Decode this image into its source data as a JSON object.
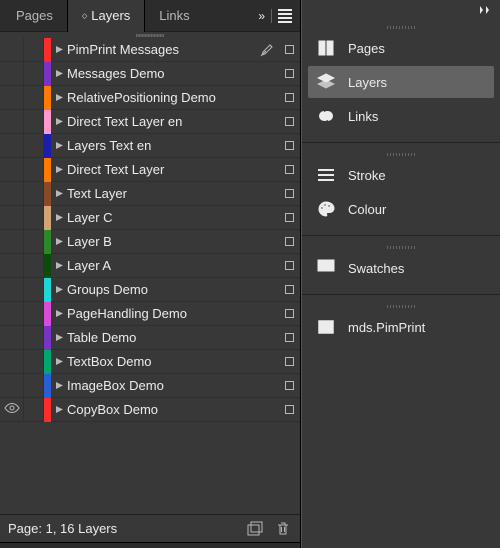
{
  "tabs": {
    "pages": "Pages",
    "layers": "Layers",
    "links": "Links"
  },
  "layers": [
    {
      "name": "PimPrint Messages",
      "color": "#ff2a2a",
      "pen": true
    },
    {
      "name": "Messages Demo",
      "color": "#7a33c7"
    },
    {
      "name": "RelativePositioning Demo",
      "color": "#ff7a00"
    },
    {
      "name": "Direct Text Layer en",
      "color": "#ff9ad0"
    },
    {
      "name": "Layers Text en",
      "color": "#1b1ea8"
    },
    {
      "name": "Direct Text Layer",
      "color": "#ff7a00"
    },
    {
      "name": "Text Layer",
      "color": "#8a4a2a"
    },
    {
      "name": "Layer C",
      "color": "#d2a578"
    },
    {
      "name": "Layer B",
      "color": "#2a8a2a"
    },
    {
      "name": "Layer A",
      "color": "#0e4a0e"
    },
    {
      "name": "Groups Demo",
      "color": "#1ed7d7"
    },
    {
      "name": "PageHandling Demo",
      "color": "#d94bd9"
    },
    {
      "name": "Table Demo",
      "color": "#7a33c7"
    },
    {
      "name": "TextBox Demo",
      "color": "#00a870"
    },
    {
      "name": "ImageBox Demo",
      "color": "#2a5ed6"
    },
    {
      "name": "CopyBox Demo",
      "color": "#ff2a2a",
      "visible": true
    }
  ],
  "footer": "Page: 1, 16 Layers",
  "dock": {
    "pages": "Pages",
    "layers": "Layers",
    "links": "Links",
    "stroke": "Stroke",
    "colour": "Colour",
    "swatches": "Swatches",
    "mds": "mds.PimPrint"
  }
}
